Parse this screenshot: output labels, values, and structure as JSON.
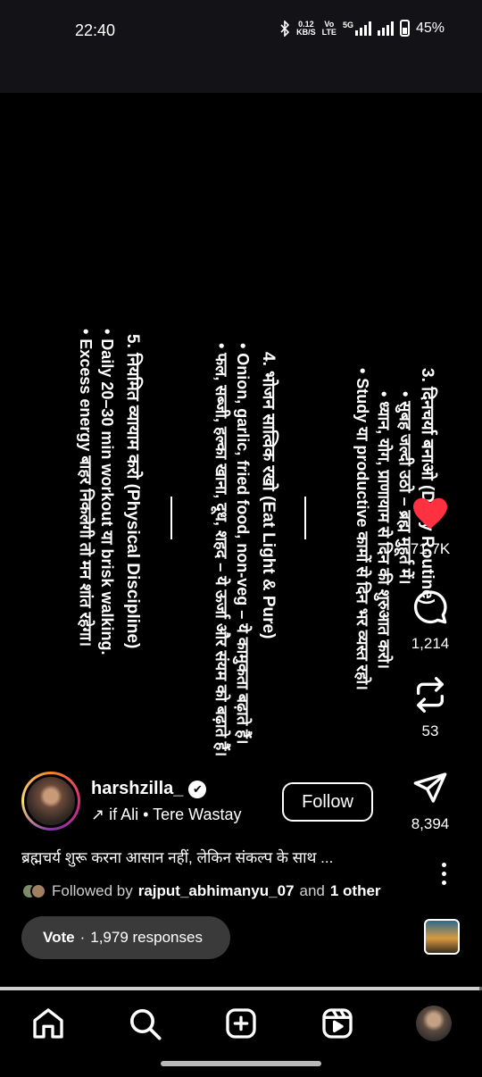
{
  "status_bar": {
    "time": "22:40",
    "net_speed_top": "0.12",
    "net_speed_bottom": "KB/S",
    "volte_top": "Vo",
    "volte_bottom": "LTE",
    "net_type": "5G",
    "battery": "45%",
    "icons": [
      "bluetooth-icon",
      "signal-icon",
      "signal-icon-2",
      "battery-icon"
    ]
  },
  "reel_text": {
    "section3": {
      "heading": "3. दिनचर्या बनाओ (Daily Routine)",
      "bullets": [
        "• सुबह जल्दी उठो – ब्रह्म मुहूर्त में।",
        "• ध्यान, योग, प्राणायाम से दिन की शुरुआत करो।",
        "• Study या productive कामों से दिन भर व्यस्त रहो।"
      ]
    },
    "section4": {
      "heading": "4. भोजन सात्विक रखो (Eat Light & Pure)",
      "bullets": [
        "• Onion, garlic, fried food, non-veg – ये कामुकता बढ़ाते हैं।",
        "• फल, सब्जी, हल्का खाना, दूध, शहद – ये ऊर्जा और संयम को बढ़ाते हैं।"
      ]
    },
    "section5": {
      "heading": "5. नियमित व्यायाम करो (Physical Discipline)",
      "bullets": [
        "• Daily 20–30 min workout या brisk walking.",
        "• Excess energy बाहर निकलेगी तो मन शांत रहेगा।"
      ]
    }
  },
  "actions": {
    "likes": "71.7K",
    "comments": "1,214",
    "reposts": "53",
    "shares": "8,394"
  },
  "post": {
    "username": "harshzilla_",
    "music_artist": "if Ali",
    "music_title": "Tere Wastay",
    "music_separator": "•",
    "follow_label": "Follow",
    "caption": "ब्रह्मचर्य शुरू करना आसान नहीं, लेकिन संकल्प के साथ ...",
    "followed_by_prefix": "Followed by",
    "followed_by_user": "rajput_abhimanyu_07",
    "followed_by_and": "and",
    "followed_by_other": "1 other"
  },
  "poll": {
    "label": "Vote",
    "separator": "·",
    "responses": "1,979 responses"
  },
  "progress": {
    "fraction": 0.995
  },
  "colors": {
    "like_red": "#ff3040",
    "background": "#000000",
    "status_bar": "#131317",
    "pill": "#3a3a3a"
  },
  "nav": {
    "items": [
      "home-icon",
      "search-icon",
      "create-icon",
      "reels-icon",
      "profile-avatar"
    ]
  }
}
